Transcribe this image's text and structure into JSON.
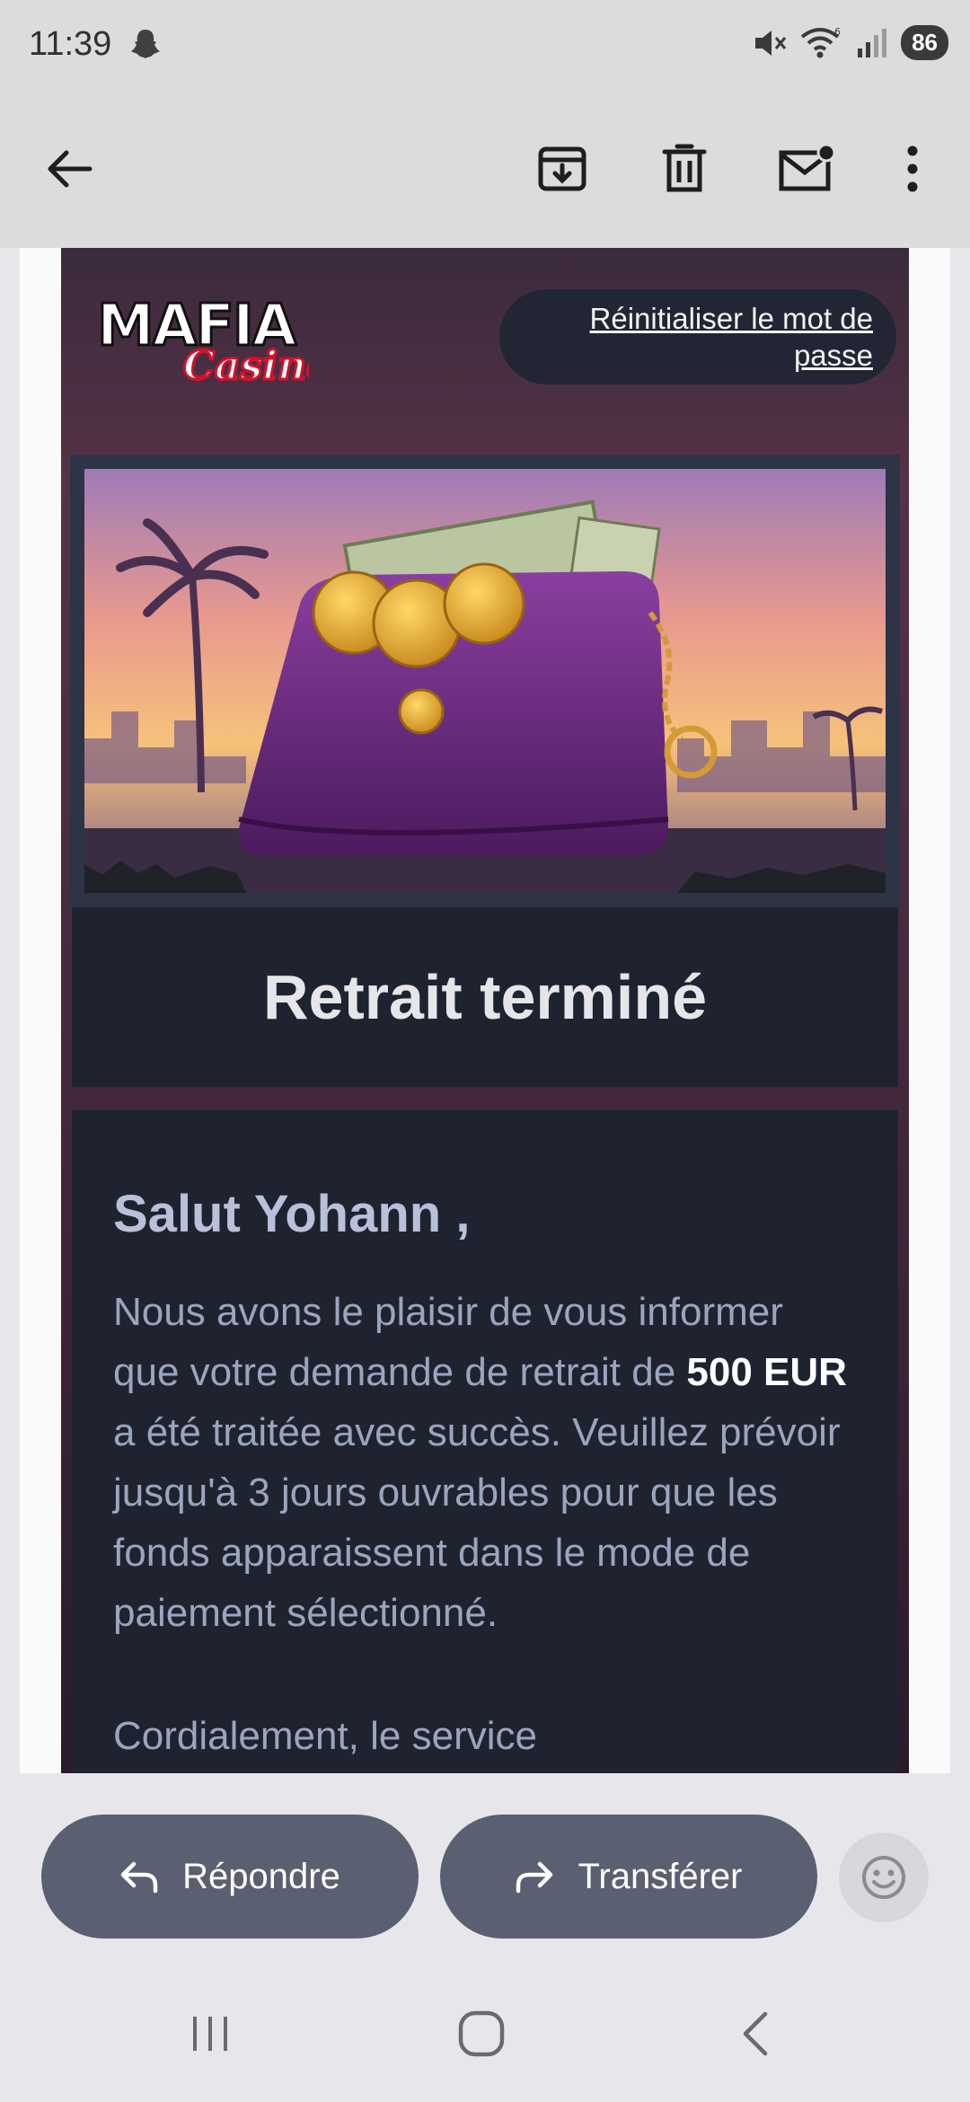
{
  "status_bar": {
    "time": "11:39",
    "battery": "86",
    "wifi_label": "6",
    "icons": [
      "snapchat-icon",
      "mute-icon",
      "wifi-icon",
      "signal-icon",
      "battery-icon"
    ]
  },
  "toolbar": {
    "icons": [
      "back-arrow-icon",
      "archive-icon",
      "delete-icon",
      "mark-unread-icon",
      "more-options-icon"
    ]
  },
  "email": {
    "brand_logo": "MAFIA Casino",
    "reset_link": "Réinitialiser le mot de passe",
    "hero_image": "purple-wallet-with-cash-and-coins",
    "title": "Retrait terminé",
    "greeting": "Salut Yohann ,",
    "paragraph_before": "Nous avons le plaisir de vous informer que votre demande de retrait de ",
    "amount": "500 EUR",
    "paragraph_after": " a été traitée avec succès. Veuillez prévoir jusqu'à 3 jours ouvrables pour que les fonds apparaissent dans le mode de paiement sélectionné.",
    "cut_off_line": "Cordialement, le service"
  },
  "actions": {
    "reply_label": "Répondre",
    "forward_label": "Transférer",
    "emoji_icon": "emoji-reaction-icon"
  },
  "nav_bar": {
    "icons": [
      "recent-apps-icon",
      "home-icon",
      "back-icon"
    ]
  },
  "colors": {
    "card_dark": "#1f2330",
    "card_plum": "#553247",
    "action_button": "#5a5f72",
    "text_muted": "#9aa5be"
  }
}
